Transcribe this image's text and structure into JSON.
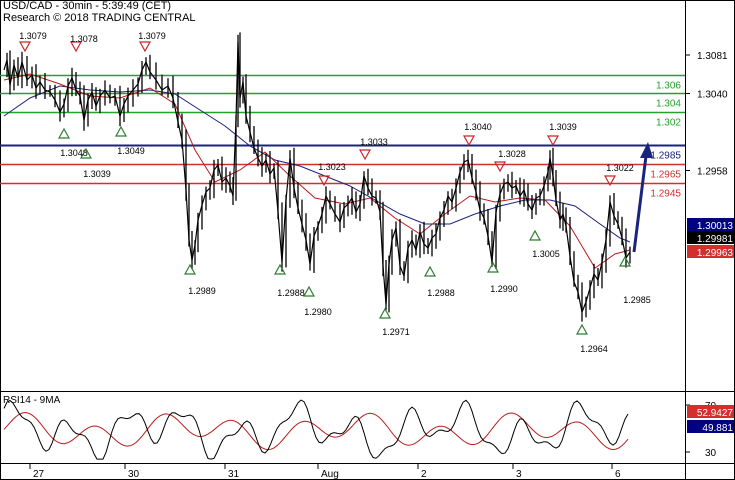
{
  "header": {
    "title": "USD/CAD - 30min - 5:39:49 (CET)",
    "credit": "Research © 2018 TRADING CENTRAL"
  },
  "chart_data": [
    {
      "type": "line",
      "title": "USD/CAD - 30min - 5:39:49 (CET)",
      "y_ticks": [
        "1.3081",
        "1.3040",
        "1.2958"
      ],
      "x_ticks": [
        "27",
        "30",
        "31",
        "Aug",
        "2",
        "3",
        "6"
      ],
      "ylim": [
        1.2925,
        1.3105
      ],
      "grid": false,
      "support_resistance": [
        {
          "label": "1.306",
          "value": 1.306,
          "color": "#22a32a"
        },
        {
          "label": "1.304",
          "value": 1.304,
          "color": "#22a32a"
        },
        {
          "label": "1.302",
          "value": 1.302,
          "color": "#22a32a"
        },
        {
          "label": "1.2985",
          "value": 1.2985,
          "color": "#1a237e"
        },
        {
          "label": "1.2965",
          "value": 1.2965,
          "color": "#d32f2f"
        },
        {
          "label": "1.2945",
          "value": 1.2945,
          "color": "#d32f2f"
        }
      ],
      "current_values": [
        {
          "label": "1.30013",
          "bg": "#000080",
          "color": "#ffffff"
        },
        {
          "label": "1.29981",
          "bg": "#000000",
          "color": "#ffffff"
        },
        {
          "label": "1.29963",
          "bg": "#d32f2f",
          "color": "#ffffff"
        }
      ],
      "peaks": [
        "1.3079",
        "1.3078",
        "1.3079",
        "1.3033",
        "1.3023",
        "1.3040",
        "1.3028",
        "1.3039",
        "1.3022"
      ],
      "troughs": [
        "1.3048",
        "1.3039",
        "1.3049",
        "1.2989",
        "1.2988",
        "1.2980",
        "1.2971",
        "1.2988",
        "1.2990",
        "1.3005",
        "1.2964",
        "1.2985"
      ],
      "series": [
        {
          "name": "",
          "color": "#000000"
        },
        {
          "name": "",
          "color": "#b71c1c"
        },
        {
          "name": "",
          "color": "#1a237e"
        }
      ],
      "projection": "up"
    },
    {
      "type": "line",
      "title": "RSI14 - 9MA",
      "y_ticks": [
        "70",
        "30"
      ],
      "ylim": [
        20,
        80
      ],
      "current_values": [
        {
          "label": "52.9427",
          "bg": "#d32f2f",
          "color": "#ffffff"
        },
        {
          "label": "49.881",
          "bg": "#000080",
          "color": "#ffffff"
        }
      ]
    }
  ]
}
